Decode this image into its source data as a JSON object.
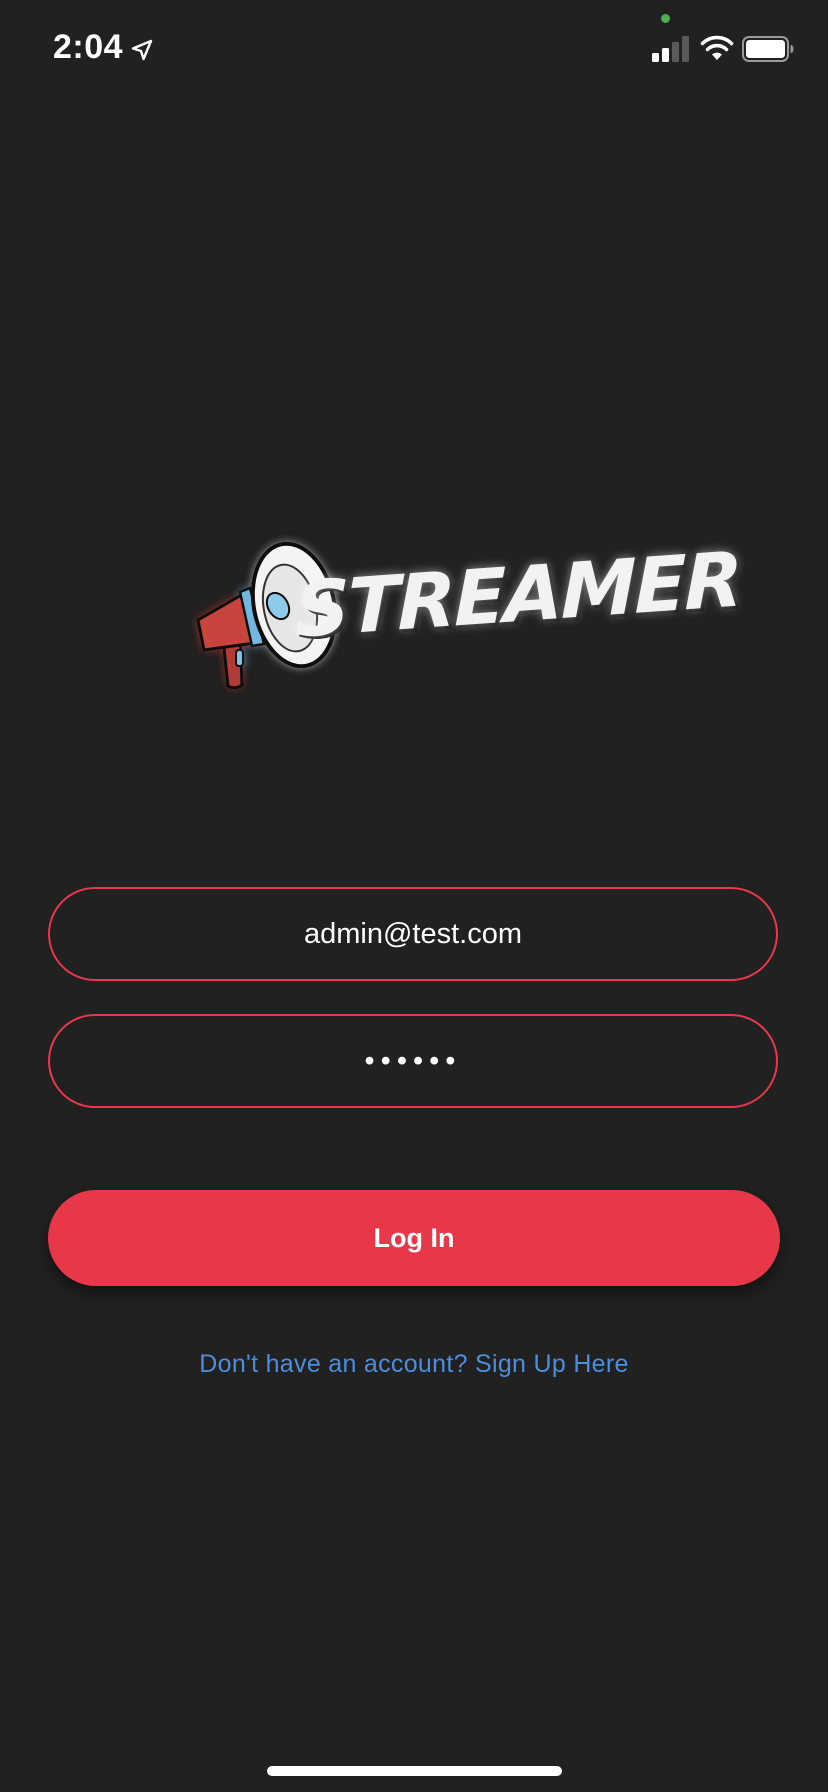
{
  "status_bar": {
    "time": "2:04",
    "location_icon": "location-arrow-icon",
    "signal_icon": "cellular-signal-icon",
    "wifi_icon": "wifi-icon",
    "battery_icon": "battery-icon",
    "camera_indicator_color": "#4caf50"
  },
  "logo": {
    "text": "STREAMER",
    "icon": "megaphone-icon"
  },
  "form": {
    "email_value": "admin@test.com",
    "password_value": "••••••",
    "login_label": "Log In",
    "signup_text": "Don't have an account? Sign Up Here"
  },
  "colors": {
    "background": "#212121",
    "accent": "#e9374a",
    "link": "#4a8fde"
  }
}
